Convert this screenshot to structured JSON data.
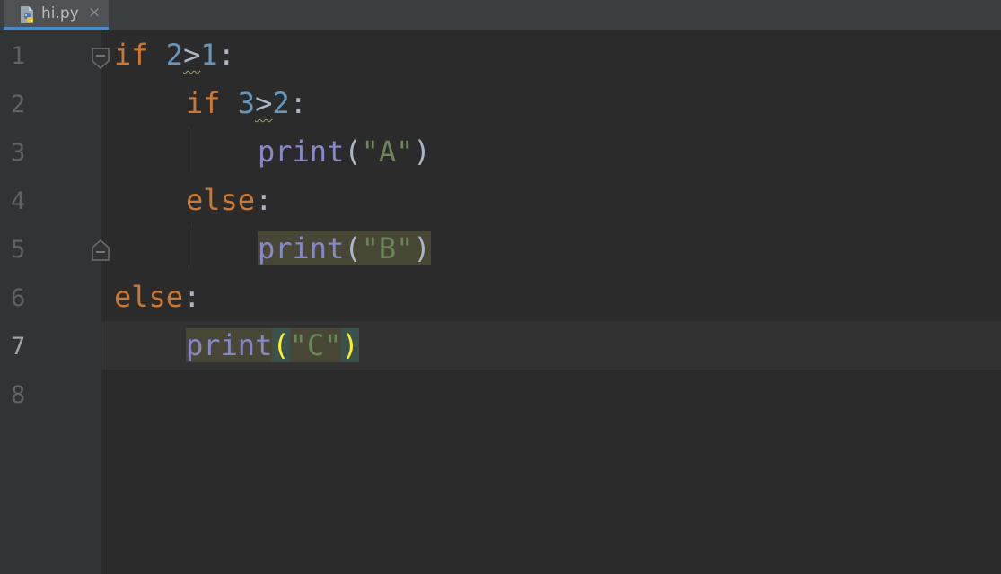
{
  "tab": {
    "file_name": "hi.py",
    "close_glyph": "×",
    "icon": "python-file-icon"
  },
  "gutter": {
    "line_numbers": [
      "1",
      "2",
      "3",
      "4",
      "5",
      "6",
      "7",
      "8"
    ],
    "current_line": "7"
  },
  "code": {
    "l1": {
      "kw": "if",
      "a": "2",
      "op": ">",
      "b": "1",
      "colon": ":"
    },
    "l2": {
      "kw": "if",
      "a": "3",
      "op": ">",
      "b": "2",
      "colon": ":"
    },
    "l3": {
      "fn": "print",
      "open": "(",
      "str": "\"A\"",
      "close": ")"
    },
    "l4": {
      "kw": "else",
      "colon": ":"
    },
    "l5": {
      "fn": "print",
      "open": "(",
      "str": "\"B\"",
      "close": ")"
    },
    "l6": {
      "kw": "else",
      "colon": ":"
    },
    "l7": {
      "fn": "print",
      "open": "(",
      "str": "\"C\"",
      "close": ")"
    }
  },
  "colors": {
    "background": "#2b2b2b",
    "gutter": "#313335",
    "keyword": "#cc7832",
    "number": "#6897bb",
    "builtin": "#8888c6",
    "string": "#6a8759",
    "default_text": "#a9b7c6",
    "brace_match": "#ffef28"
  }
}
